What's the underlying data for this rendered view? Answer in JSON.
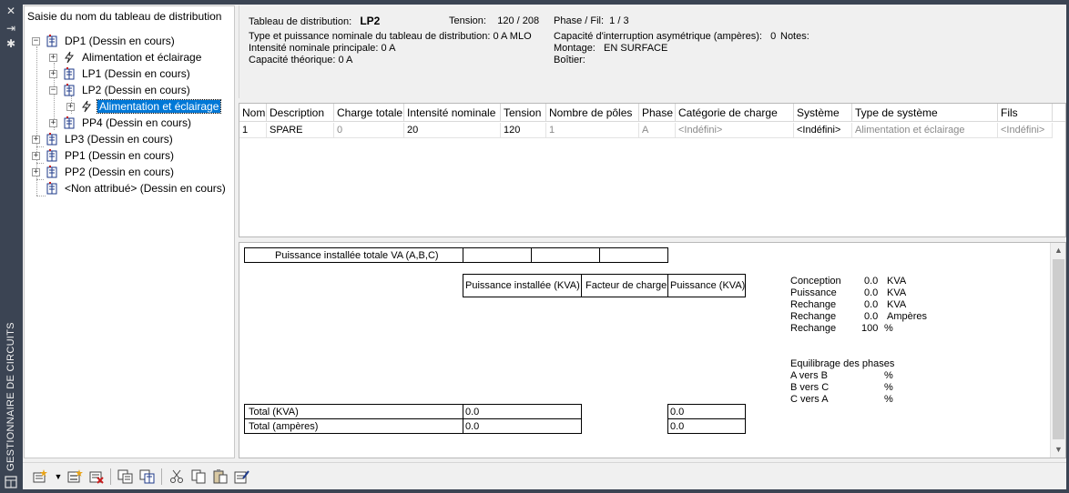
{
  "app": {
    "side_title": "GESTIONNAIRE DE CIRCUITS"
  },
  "tree": {
    "title": "Saisie du nom du tableau de distribution",
    "nodes": [
      {
        "label": "DP1 (Dessin en cours)"
      },
      {
        "label": "Alimentation et éclairage"
      },
      {
        "label": "LP1 (Dessin en cours)"
      },
      {
        "label": "LP2 (Dessin en cours)"
      },
      {
        "label": "Alimentation et éclairage"
      },
      {
        "label": "PP4 (Dessin en cours)"
      },
      {
        "label": "LP3 (Dessin en cours)"
      },
      {
        "label": "PP1 (Dessin en cours)"
      },
      {
        "label": "PP2 (Dessin en cours)"
      },
      {
        "label": "<Non attribué> (Dessin en cours)"
      }
    ]
  },
  "info": {
    "panel_label": "Tableau de distribution:",
    "panel_value": "LP2",
    "tension_label": "Tension:",
    "tension_value": "120 / 208",
    "phase_label": "Phase / Fil:",
    "phase_value": "1 /  3",
    "type_line": "Type et puissance nominale du tableau de distribution: 0 A MLO",
    "main_current_line": "Intensité nominale principale: 0 A",
    "capacity_line": "Capacité théorique: 0 A",
    "interrupt_label": "Capacité d'interruption asymétrique (ampères):",
    "interrupt_value": "0",
    "notes_label": "Notes:",
    "mounting_label": "Montage:",
    "mounting_value": "EN SURFACE",
    "enclosure_label": "Boîtier:"
  },
  "table": {
    "columns": [
      "Nom",
      "Description",
      "Charge totale",
      "Intensité nominale",
      "Tension",
      "Nombre de pôles",
      "Phase",
      "Catégorie de charge",
      "Système",
      "Type de système",
      "Fils"
    ],
    "rows": [
      [
        "1",
        "SPARE",
        "0",
        "20",
        "120",
        "1",
        "A",
        "<Indéfini>",
        "<Indéfini>",
        "Alimentation et éclairage",
        "<Indéfini>"
      ]
    ]
  },
  "summary": {
    "total_installed_label": "Puissance installée totale VA (A,B,C)",
    "col_installed_kva": "Puissance installée (KVA)",
    "col_load_factor": "Facteur de charge",
    "col_power_kva": "Puissance (KVA)",
    "total_kva_label": "Total (KVA)",
    "total_kva_installed": "0.0",
    "total_kva_power": "0.0",
    "total_amps_label": "Total (ampères)",
    "total_amps_installed": "0.0",
    "total_amps_power": "0.0",
    "stats": [
      {
        "label": "Conception",
        "value": "0.0",
        "unit": "KVA"
      },
      {
        "label": "Puissance",
        "value": "0.0",
        "unit": "KVA"
      },
      {
        "label": "Rechange",
        "value": "0.0",
        "unit": "KVA"
      },
      {
        "label": "Rechange",
        "value": "0.0",
        "unit": "Ampères"
      },
      {
        "label": "Rechange",
        "value": "100",
        "unit": "%"
      }
    ],
    "balance_title": "Equilibrage des phases",
    "balance": [
      {
        "label": "A vers B",
        "unit": "%"
      },
      {
        "label": "B vers C",
        "unit": "%"
      },
      {
        "label": "C vers A",
        "unit": "%"
      }
    ]
  },
  "colors": {
    "accent": "#0078d7",
    "frame": "#3b4453"
  }
}
